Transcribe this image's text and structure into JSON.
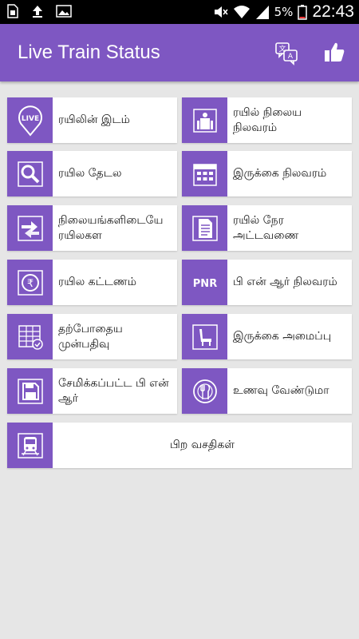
{
  "statusbar": {
    "battery_percent": "5%",
    "time": "22:43",
    "left_icons": [
      "sim-card-icon",
      "upload-icon",
      "image-icon"
    ],
    "right_icons": [
      "mute-icon",
      "wifi-icon",
      "signal-icon",
      "battery-icon"
    ]
  },
  "appbar": {
    "title": "Live Train Status",
    "actions": [
      "translate-icon",
      "thumbs-up-icon"
    ],
    "color": "#7e57c2"
  },
  "tiles": [
    {
      "label": "ரயிலின் இடம்",
      "icon": "live-location-icon"
    },
    {
      "label": "ரயில் நிலைய நிலவரம்",
      "icon": "station-icon"
    },
    {
      "label": "ரயில தேடல",
      "icon": "search-icon"
    },
    {
      "label": "இருக்கை நிலவரம்",
      "icon": "calendar-icon"
    },
    {
      "label": "நிலையங்களிடையே ரயிலகள",
      "icon": "swap-arrows-icon"
    },
    {
      "label": "ரயில் நேர அட்டவணை",
      "icon": "document-icon"
    },
    {
      "label": "ரயில கட்டணம்",
      "icon": "rupee-icon"
    },
    {
      "label": "பி என் ஆர் நிலவரம்",
      "icon": "pnr-icon"
    },
    {
      "label": "தற்போதைய முன்பதிவு",
      "icon": "booking-grid-icon"
    },
    {
      "label": "இருக்கை அமைப்பு",
      "icon": "seat-icon"
    },
    {
      "label": "சேமிக்கப்பட்ட பி என் ஆர்",
      "icon": "save-icon"
    },
    {
      "label": "உணவு வேண்டுமா",
      "icon": "food-icon"
    },
    {
      "label": "பிற வசதிகள்",
      "icon": "train-icon"
    }
  ],
  "pnr_text": "PNR",
  "live_text": "LIVE"
}
